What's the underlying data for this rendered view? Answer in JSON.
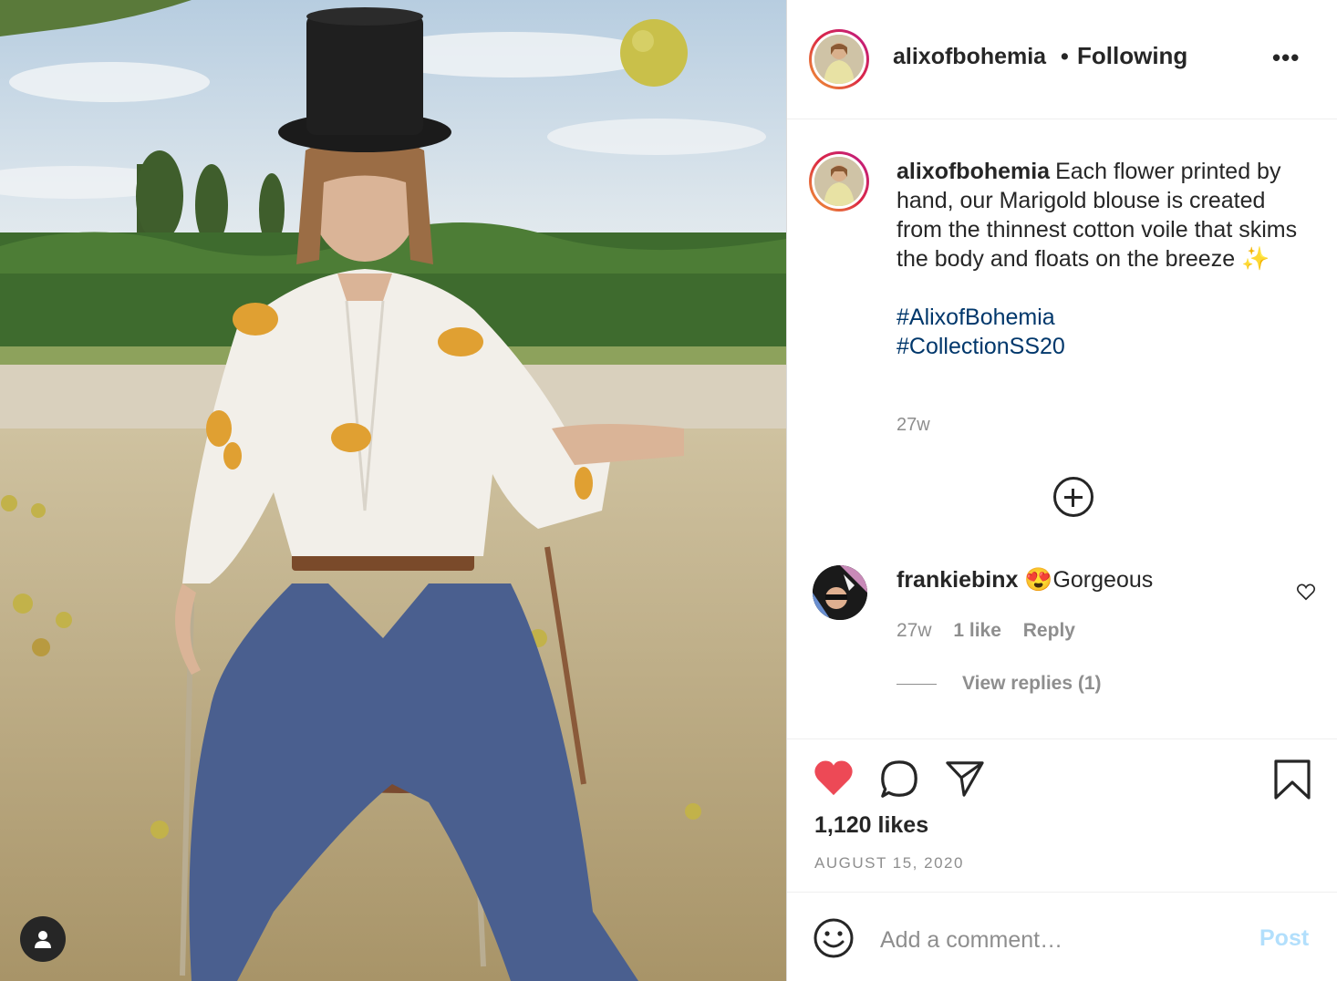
{
  "post": {
    "username": "alixofbohemia",
    "follow_separator": "•",
    "follow_status": "Following",
    "more_label": "•••"
  },
  "caption": {
    "username": "alixofbohemia",
    "text": "Each flower printed by hand, our Marigold blouse is created from the thinnest cotton voile that skims the body and floats on the breeze ✨",
    "hashtags": [
      "#AlixofBohemia",
      "#CollectionSS20"
    ],
    "time": "27w"
  },
  "comment": {
    "username": "frankiebinx",
    "text": "😍Gorgeous",
    "time": "27w",
    "likes": "1 like",
    "reply": "Reply",
    "view_replies": "View replies (1)"
  },
  "stats": {
    "likes": "1,120 likes",
    "date": "AUGUST 15, 2020"
  },
  "composer": {
    "placeholder": "Add a comment…",
    "post_label": "Post"
  },
  "colors": {
    "liked_heart": "#ed4956",
    "hashtag": "#00376b",
    "post_disabled": "#b2dffc",
    "muted": "#8e8e8e"
  },
  "icons": [
    "user-tag-icon",
    "more-options-icon",
    "load-more-comments-icon",
    "comment-like-heart-icon",
    "like-heart-icon",
    "comment-icon",
    "share-icon",
    "bookmark-icon",
    "emoji-icon"
  ]
}
